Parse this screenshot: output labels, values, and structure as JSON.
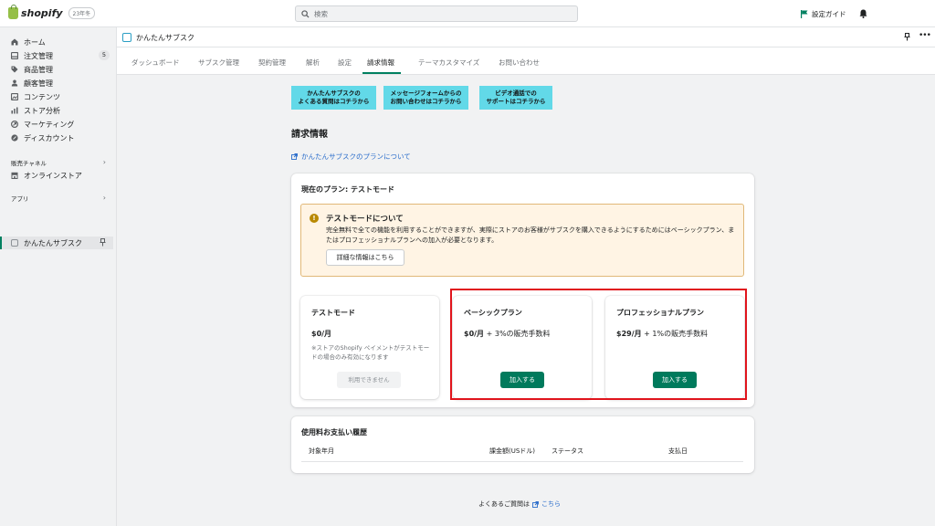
{
  "topbar": {
    "logo_text": "shopify",
    "logo_badge": "23年冬",
    "search_placeholder": "検索",
    "guide_label": "設定ガイド"
  },
  "sidebar": {
    "items": [
      {
        "label": "ホーム",
        "icon": "home-icon"
      },
      {
        "label": "注文管理",
        "icon": "orders-icon",
        "badge": "5"
      },
      {
        "label": "商品管理",
        "icon": "tag-icon"
      },
      {
        "label": "顧客管理",
        "icon": "person-icon"
      },
      {
        "label": "コンテンツ",
        "icon": "content-icon"
      },
      {
        "label": "ストア分析",
        "icon": "analytics-icon"
      },
      {
        "label": "マーケティング",
        "icon": "marketing-icon"
      },
      {
        "label": "ディスカウント",
        "icon": "discount-icon"
      }
    ],
    "sales_channels_label": "販売チャネル",
    "online_store_label": "オンラインストア",
    "apps_label": "アプリ",
    "active_app_label": "かんたんサブスク"
  },
  "app_header": {
    "title": "かんたんサブスク"
  },
  "tabs": [
    {
      "label": "ダッシュボード"
    },
    {
      "label": "サブスク管理"
    },
    {
      "label": "契約管理"
    },
    {
      "label": "解析"
    },
    {
      "label": "設定"
    },
    {
      "label": "請求情報",
      "active": true
    },
    {
      "label": "テーマカスタマイズ"
    },
    {
      "label": "お問い合わせ"
    }
  ],
  "help_buttons": [
    {
      "line1": "かんたんサブスクの",
      "line2": "よくある質問はコチラから"
    },
    {
      "line1": "メッセージフォームからの",
      "line2": "お問い合わせはコチラから"
    },
    {
      "line1": "ビデオ通話での",
      "line2": "サポートはコチラから"
    }
  ],
  "page": {
    "title": "請求情報",
    "plan_link": "かんたんサブスクのプランについて",
    "current_plan": "現在のプラン: テストモード"
  },
  "banner": {
    "title": "テストモードについて",
    "body": "完全無料で全ての機能を利用することができますが、実際にストアのお客様がサブスクを購入できるようにするためにはベーシックプラン、またはプロフェッショナルプランへの加入が必要となります。",
    "button": "詳細な情報はこちら"
  },
  "plans": [
    {
      "name": "テストモード",
      "price": "$0/月",
      "fee": "",
      "note": "※ストアのShopify ペイメントがテストモードの場合のみ有効になります",
      "button": "利用できません"
    },
    {
      "name": "ベーシックプラン",
      "price": "$0/月",
      "fee": " + 3%の販売手数料",
      "note": "",
      "button": "加入する"
    },
    {
      "name": "プロフェッショナルプラン",
      "price": "$29/月",
      "fee": " + 1%の販売手数料",
      "note": "",
      "button": "加入する"
    }
  ],
  "history": {
    "title": "使用料お支払い履歴",
    "columns": [
      "対象年月",
      "課金額(USドル)",
      "ステータス",
      "支払日"
    ]
  },
  "footer": {
    "faq_text": "よくあるご質問は",
    "faq_link": "こちら"
  },
  "colors": {
    "accent_green": "#008060",
    "cyan_button": "#62d9e8",
    "highlight_red": "#e0141c",
    "banner_bg": "#fff4e4"
  }
}
